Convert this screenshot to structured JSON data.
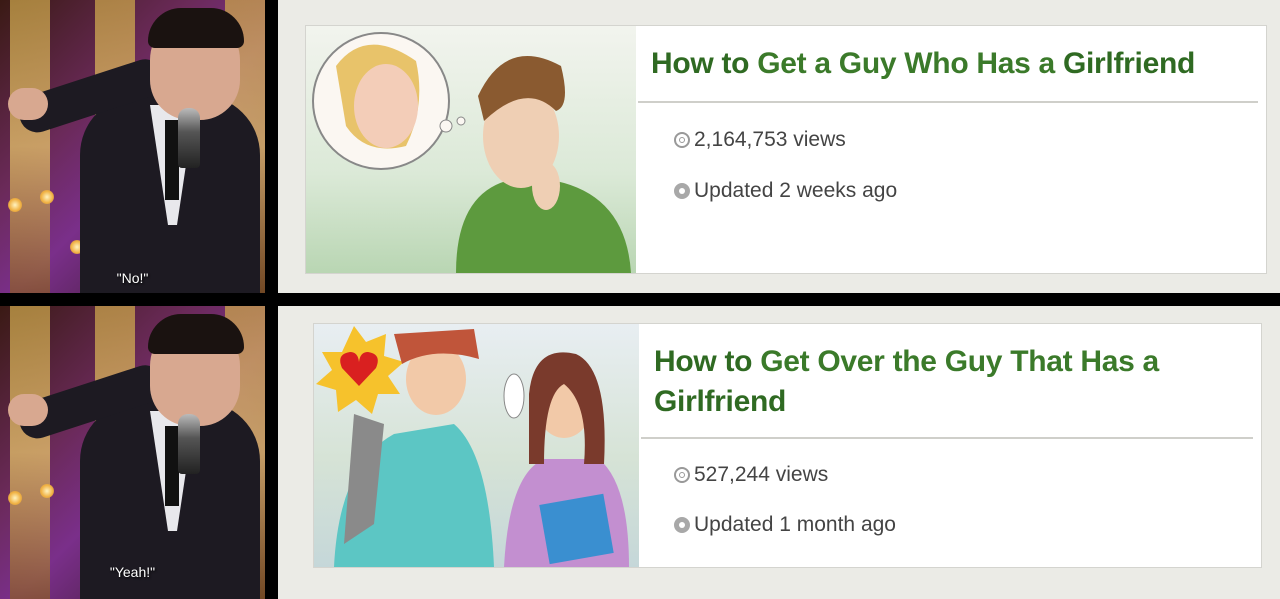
{
  "panels": [
    {
      "caption": "\"No!\"",
      "article": {
        "title_prefix": "How to",
        "title_middle": "Get a Guy Who Has a",
        "title_suffix": "Girlfriend",
        "views": "2,164,753 views",
        "updated": "Updated 2 weeks ago"
      }
    },
    {
      "caption": "\"Yeah!\"",
      "article": {
        "title_prefix": "How to",
        "title_middle": "Get Over the Guy That Has a",
        "title_suffix": "Girlfriend",
        "views": "527,244 views",
        "updated": "Updated 1 month ago"
      }
    }
  ],
  "colors": {
    "title_green": "#3b7a2a",
    "card_background": "#ebebe6",
    "separator": "#000000"
  },
  "icons": {
    "views": "eye-icon",
    "updated": "refresh-icon"
  }
}
